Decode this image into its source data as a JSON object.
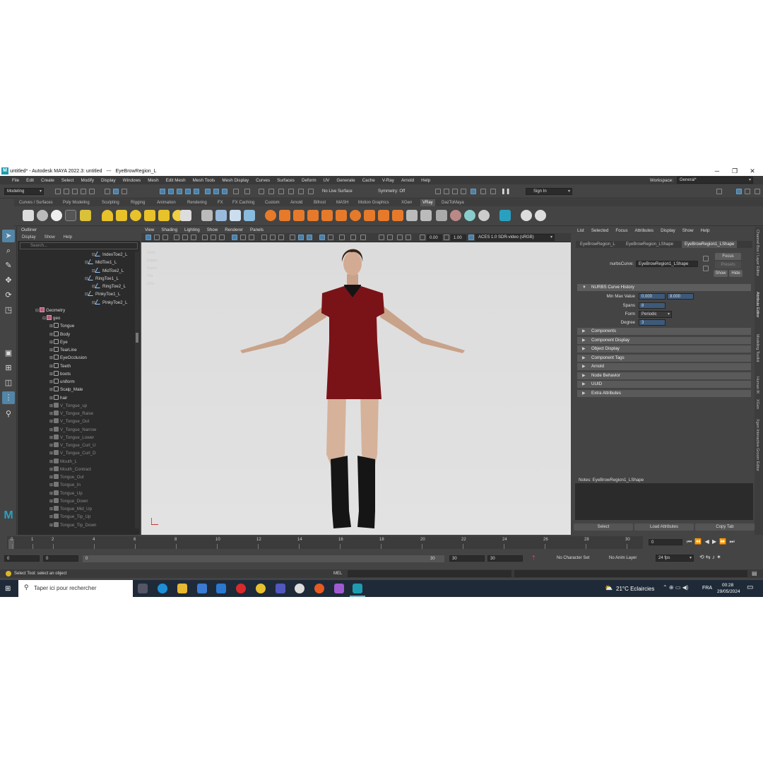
{
  "window": {
    "title": "untitled* - Autodesk MAYA 2022.3: untitled",
    "selection": "EyeBrowRegion_L",
    "logo": "M",
    "minimize": "─",
    "maximize": "❐",
    "close": "✕"
  },
  "menubar": [
    "File",
    "Edit",
    "Create",
    "Select",
    "Modify",
    "Display",
    "Windows",
    "Mesh",
    "Edit Mesh",
    "Mesh Tools",
    "Mesh Display",
    "Curves",
    "Surfaces",
    "Deform",
    "UV",
    "Generate",
    "Cache",
    "V-Ray",
    "Arnold",
    "Help"
  ],
  "workspace": {
    "label": "Workspace:",
    "value": "General*"
  },
  "statusline": {
    "mode": "Modeling",
    "live_surface": "No Live Surface",
    "symmetry": "Symmetry: Off",
    "sign_in": "Sign In"
  },
  "shelf_tabs": [
    "Curves / Surfaces",
    "Poly Modeling",
    "Sculpting",
    "Rigging",
    "Animation",
    "Rendering",
    "FX",
    "FX Caching",
    "Custom",
    "Arnold",
    "Bifrost",
    "MASH",
    "Motion Graphics",
    "XGen",
    "VRay",
    "DazToMaya"
  ],
  "shelf_active": "VRay",
  "outliner": {
    "title": "Outliner",
    "menu": [
      "Display",
      "Show",
      "Help"
    ],
    "search_placeholder": "Search...",
    "rows": [
      {
        "label": "IndexToe2_L",
        "type": "joint",
        "indent": 100,
        "dim": false
      },
      {
        "label": "MidToe1_L",
        "type": "joint",
        "indent": 90,
        "dim": false
      },
      {
        "label": "MidToe2_L",
        "type": "joint",
        "indent": 100,
        "dim": false
      },
      {
        "label": "RingToe1_L",
        "type": "joint",
        "indent": 90,
        "dim": false
      },
      {
        "label": "RingToe2_L",
        "type": "joint",
        "indent": 100,
        "dim": false
      },
      {
        "label": "PinkyToe1_L",
        "type": "joint",
        "indent": 90,
        "dim": false
      },
      {
        "label": "PinkyToe2_L",
        "type": "joint",
        "indent": 100,
        "dim": false
      },
      {
        "label": "Geometry",
        "type": "group",
        "indent": 20,
        "dim": false
      },
      {
        "label": "geo",
        "type": "group",
        "indent": 30,
        "dim": false
      },
      {
        "label": "Tongue",
        "type": "mesh",
        "indent": 40,
        "dim": false
      },
      {
        "label": "Body",
        "type": "mesh",
        "indent": 40,
        "dim": false
      },
      {
        "label": "Eye",
        "type": "mesh",
        "indent": 40,
        "dim": false
      },
      {
        "label": "TearLine",
        "type": "mesh",
        "indent": 40,
        "dim": false
      },
      {
        "label": "EyeOcclusion",
        "type": "mesh",
        "indent": 40,
        "dim": false
      },
      {
        "label": "Teeth",
        "type": "mesh",
        "indent": 40,
        "dim": false
      },
      {
        "label": "boots",
        "type": "mesh",
        "indent": 40,
        "dim": false
      },
      {
        "label": "uniform",
        "type": "mesh",
        "indent": 40,
        "dim": false
      },
      {
        "label": "Scalp_Male",
        "type": "mesh",
        "indent": 40,
        "dim": false
      },
      {
        "label": "hair",
        "type": "mesh",
        "indent": 40,
        "dim": false
      },
      {
        "label": "V_Tongue_up",
        "type": "blend",
        "indent": 40,
        "dim": true
      },
      {
        "label": "V_Tongue_Raise",
        "type": "blend",
        "indent": 40,
        "dim": true
      },
      {
        "label": "V_Tongue_Out",
        "type": "blend",
        "indent": 40,
        "dim": true
      },
      {
        "label": "V_Tongue_Narrow",
        "type": "blend",
        "indent": 40,
        "dim": true
      },
      {
        "label": "V_Tongue_Lower",
        "type": "blend",
        "indent": 40,
        "dim": true
      },
      {
        "label": "V_Tongue_Curl_U",
        "type": "blend",
        "indent": 40,
        "dim": true
      },
      {
        "label": "V_Tongue_Curl_D",
        "type": "blend",
        "indent": 40,
        "dim": true
      },
      {
        "label": "Mouth_L",
        "type": "blend",
        "indent": 40,
        "dim": true
      },
      {
        "label": "Mouth_Contract",
        "type": "blend",
        "indent": 40,
        "dim": true
      },
      {
        "label": "Tongue_Out",
        "type": "blend",
        "indent": 40,
        "dim": true
      },
      {
        "label": "Tongue_In",
        "type": "blend",
        "indent": 40,
        "dim": true
      },
      {
        "label": "Tongue_Up",
        "type": "blend",
        "indent": 40,
        "dim": true
      },
      {
        "label": "Tongue_Down",
        "type": "blend",
        "indent": 40,
        "dim": true
      },
      {
        "label": "Tongue_Mid_Up",
        "type": "blend",
        "indent": 40,
        "dim": true
      },
      {
        "label": "Tongue_Tip_Up",
        "type": "blend",
        "indent": 40,
        "dim": true
      },
      {
        "label": "Tongue_Tip_Down",
        "type": "blend",
        "indent": 40,
        "dim": true
      }
    ]
  },
  "viewport": {
    "menu": [
      "View",
      "Shading",
      "Lighting",
      "Show",
      "Renderer",
      "Panels"
    ],
    "value_a": "0.00",
    "value_b": "1.00",
    "color_space": "ACES 1.0 SDR-video (sRGB)",
    "hud": [
      "Verts:",
      "Edges:",
      "Faces:",
      "Tris:",
      "UVs:"
    ]
  },
  "attribute_editor": {
    "menu": [
      "List",
      "Selected",
      "Focus",
      "Attributes",
      "Display",
      "Show",
      "Help"
    ],
    "tabs": [
      "EyeBrowRegion_L",
      "EyeBrowRegion_LShape",
      "EyeBrowRegion1_LShape"
    ],
    "active_tab": "EyeBrowRegion1_LShape",
    "node_label": "nurbsCurve:",
    "node_value": "EyeBrowRegion1_LShape",
    "focus": "Focus",
    "presets": "Presets",
    "show": "Show",
    "hide": "Hide",
    "history_section": "NURBS Curve History",
    "min_max_label": "Min Max Value",
    "min_value": "0.000",
    "max_value": "8.000",
    "spans_label": "Spans",
    "spans_value": "8",
    "form_label": "Form",
    "form_value": "Periodic",
    "degree_label": "Degree",
    "degree_value": "3",
    "sections": [
      "Components",
      "Component Display",
      "Object Display",
      "Component Tags",
      "Arnold",
      "Node Behavior",
      "UUID",
      "Extra Attributes"
    ],
    "notes": "Notes:  EyeBrowRegion1_LShape",
    "buttons": [
      "Select",
      "Load Attributes",
      "Copy Tab"
    ],
    "side_tabs": [
      "Channel Box / Layer Editor",
      "Attribute Editor",
      "Modeling Toolkit",
      "Human IK",
      "XGen",
      "Xgen Interactive Groom Editor"
    ]
  },
  "timeslider": {
    "ticks": [
      "0",
      "1",
      "2",
      "4",
      "6",
      "8",
      "10",
      "12",
      "14",
      "16",
      "18",
      "20",
      "22",
      "24",
      "26",
      "28",
      "30"
    ],
    "current_frame": "0",
    "range": {
      "start": "0",
      "inner_start": "0",
      "inner_start2": "0",
      "inner_end": "30",
      "end": "30",
      "end2": "30"
    },
    "character_set": "No Character Set",
    "anim_layer": "No Anim Layer",
    "fps": "24 fps"
  },
  "command_line": {
    "help": "Select Tool: select an object",
    "lang": "MEL"
  },
  "taskbar": {
    "search": "Taper ici pour rechercher",
    "weather": "21°C  Eclaircies",
    "lang": "FRA",
    "time": "00:28",
    "date": "29/05/2024"
  },
  "colors": {
    "accent": "#5285a6",
    "dress": "#7a1318",
    "boots": "#151515"
  }
}
